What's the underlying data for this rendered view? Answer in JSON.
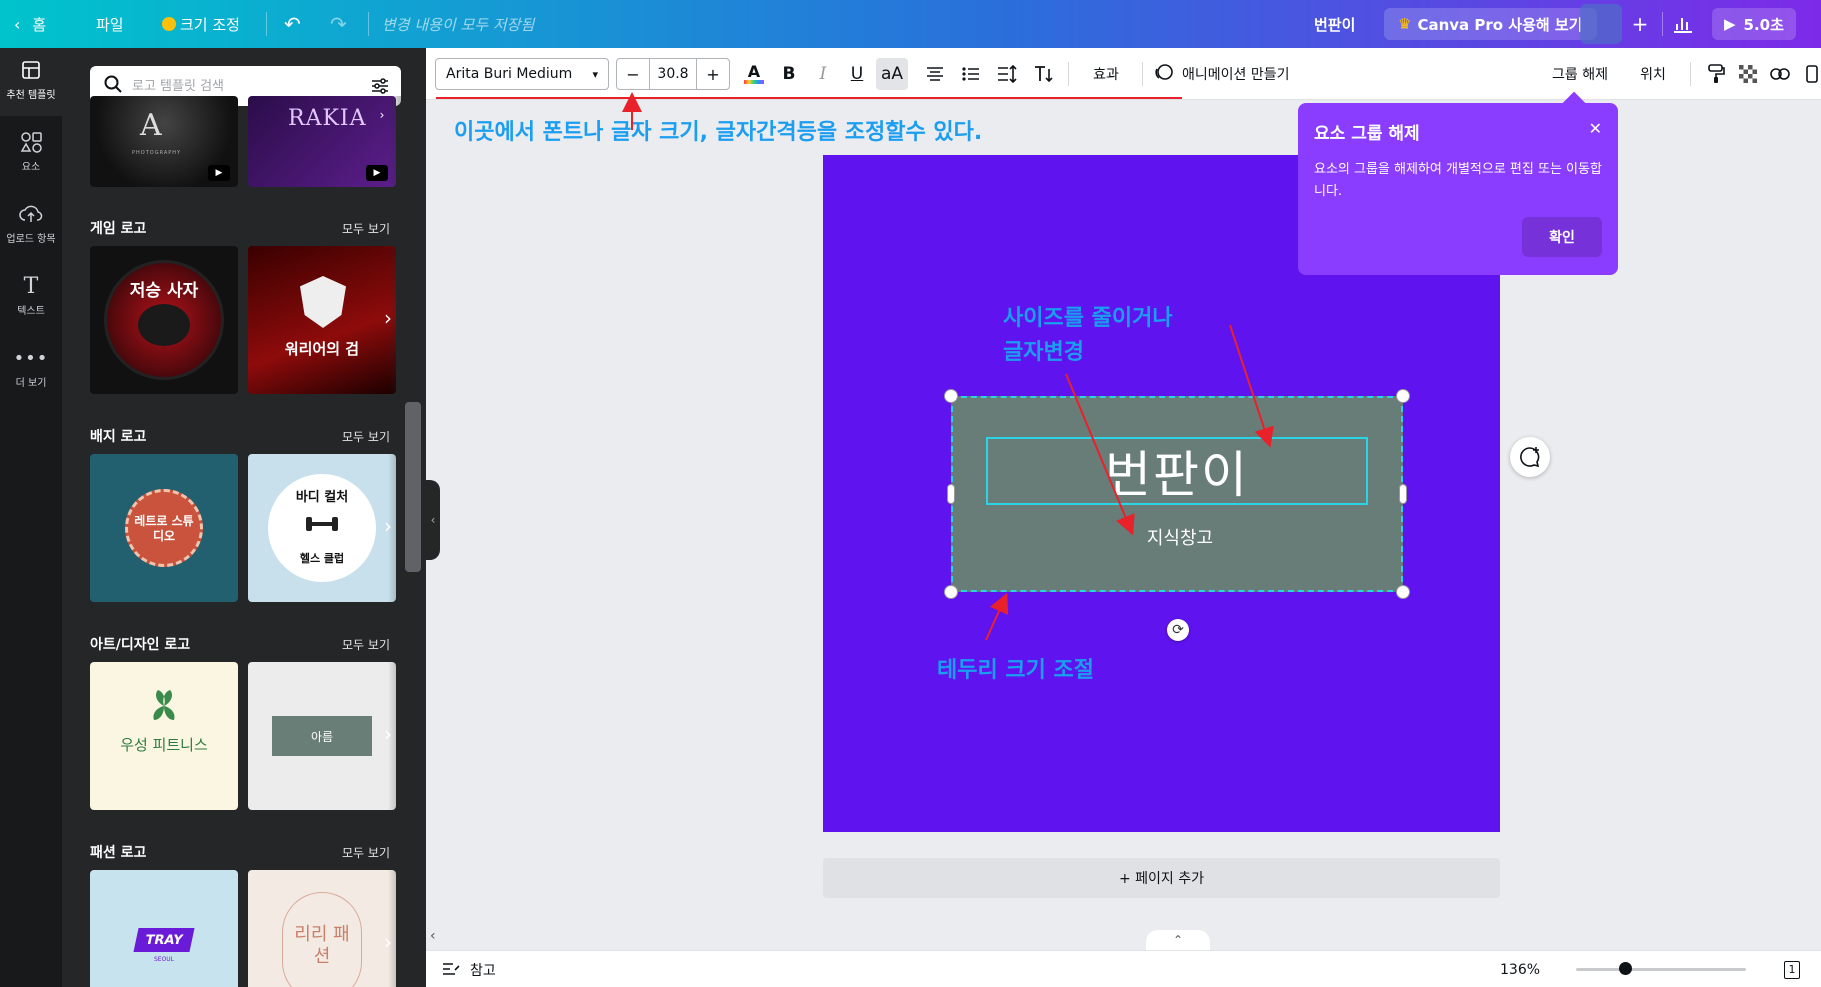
{
  "topbar": {
    "home": "홈",
    "file": "파일",
    "resize": "크기 조정",
    "saved_status": "변경 내용이 모두 저장됨",
    "design_title": "번판이",
    "pro_button": "Canva Pro 사용해 보기",
    "present": "5.0초"
  },
  "rail": {
    "items": [
      {
        "label": "추천 템플릿",
        "icon": "layout-icon"
      },
      {
        "label": "요소",
        "icon": "elements-icon"
      },
      {
        "label": "업로드 항목",
        "icon": "upload-icon"
      },
      {
        "label": "텍스트",
        "icon": "text-icon"
      },
      {
        "label": "더 보기",
        "icon": "more-icon"
      }
    ]
  },
  "panel": {
    "search_placeholder": "로고 템플릿 검색",
    "top_row": [
      "",
      "RAKIA"
    ],
    "sections": [
      {
        "title": "게임 로고",
        "see_all": "모두 보기",
        "thumbs": [
          "저승 사자",
          "워리어의 검"
        ]
      },
      {
        "title": "배지 로고",
        "see_all": "모두 보기",
        "thumbs": [
          "레트로 스튜디오",
          "바디 컬처"
        ]
      },
      {
        "title": "아트/디자인 로고",
        "see_all": "모두 보기",
        "thumbs": [
          "우성 피트니스",
          "아름"
        ]
      },
      {
        "title": "패션 로고",
        "see_all": "모두 보기",
        "thumbs": [
          "TRAY",
          "리리 패션"
        ]
      }
    ],
    "gym_bottom": "헬스 클럽",
    "tray_sub": "SEOUL"
  },
  "toolbar": {
    "font": "Arita Buri Medium",
    "font_size": "30.8",
    "effects": "효과",
    "animate": "애니메이션 만들기",
    "ungroup": "그룹 해제",
    "position": "위치"
  },
  "canvas": {
    "title_text": "번판이",
    "sub_text": "지식창고",
    "add_page": "+ 페이지 추가"
  },
  "annotations": {
    "top": "이곳에서 폰트나 글자 크기, 글자간격등을 조정할수 있다.",
    "size_line1": "사이즈를 줄이거나",
    "size_line2": "글자변경",
    "border": "테두리 크기 조절"
  },
  "tooltip": {
    "title": "요소 그룹 해제",
    "body": "요소의 그룹을 해제하여 개별적으로 편집 또는 이동합니다.",
    "confirm": "확인"
  },
  "bottombar": {
    "notes": "참고",
    "zoom": "136%",
    "page_num": "1"
  },
  "colors": {
    "page_bg": "#5f13ef",
    "group_bg": "#687c78",
    "selection": "#2ad3e5",
    "annotation": "#1b9ef0",
    "arrow": "#e8212b",
    "tooltip": "#8b3dff"
  }
}
